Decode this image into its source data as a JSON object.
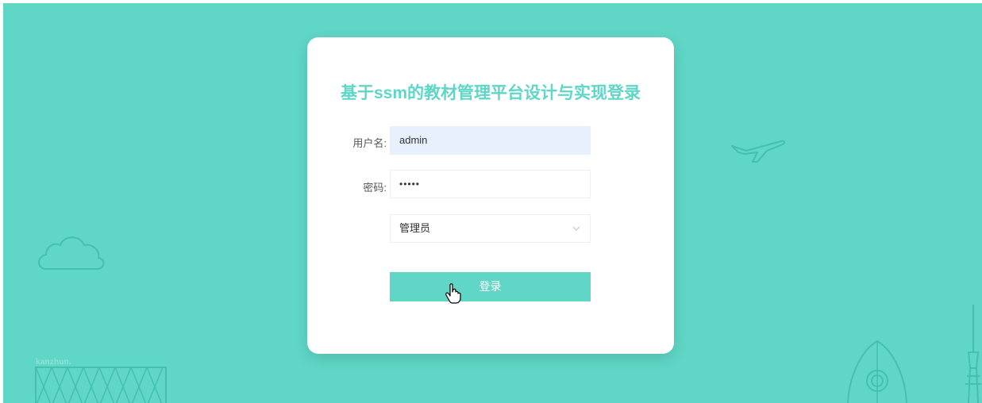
{
  "page": {
    "title": "基于ssm的教材管理平台设计与实现登录"
  },
  "form": {
    "username_label": "用户名:",
    "username_value": "admin",
    "password_label": "密码:",
    "password_value": "•••••",
    "role_selected": "管理员",
    "login_label": "登录"
  },
  "decor": {
    "brand_text": "kanzhun."
  },
  "colors": {
    "accent": "#5fd6c6",
    "background": "#5fd6c6",
    "autofill": "#e8f0fe"
  },
  "icons": [
    "cloud-icon",
    "airplane-icon",
    "chevron-down-icon",
    "hand-cursor-icon",
    "rocket-icon",
    "tower-icon"
  ]
}
